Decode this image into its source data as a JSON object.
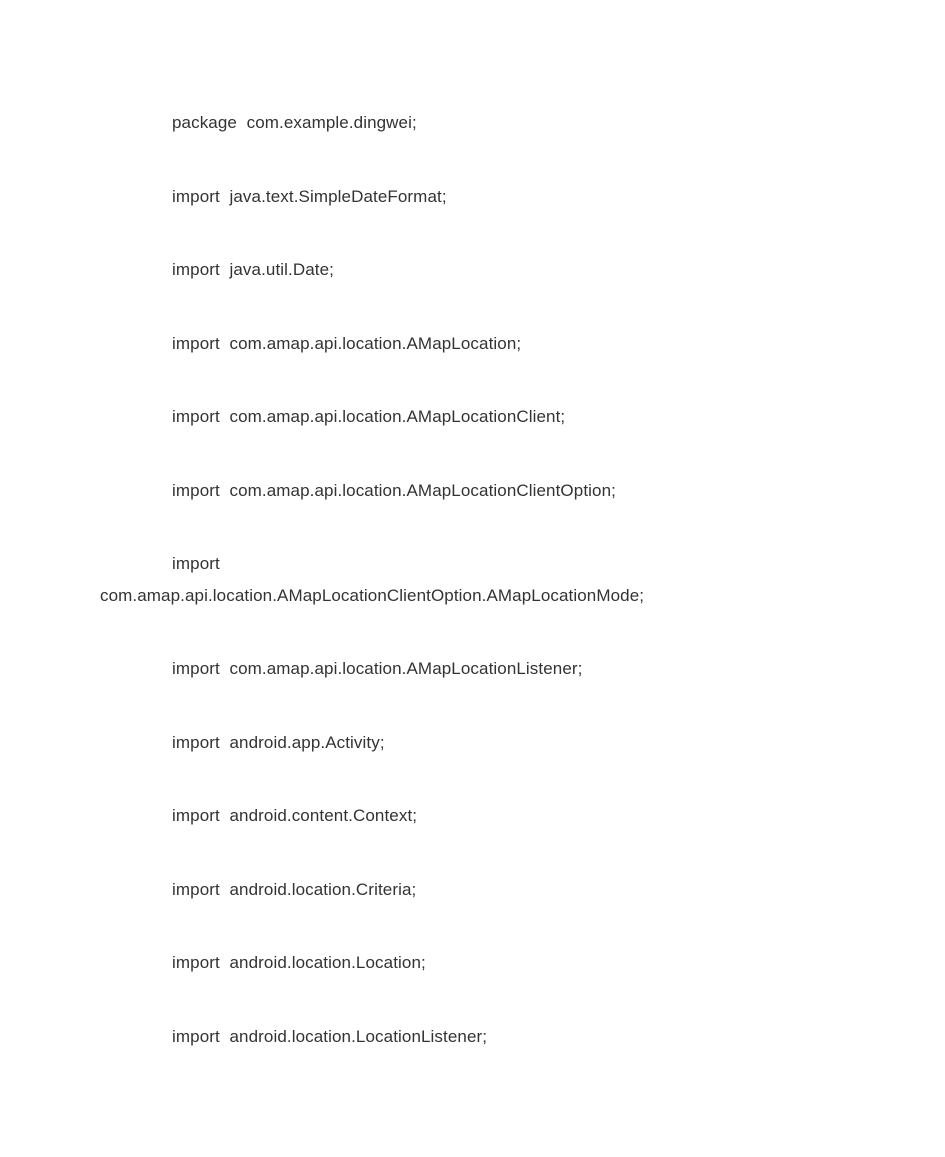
{
  "code": {
    "lines": [
      "package  com.example.dingwei;",
      "import  java.text.SimpleDateFormat;",
      "import  java.util.Date;",
      "import  com.amap.api.location.AMapLocation;",
      "import  com.amap.api.location.AMapLocationClient;",
      "import  com.amap.api.location.AMapLocationClientOption;"
    ],
    "wrapped_import_head": "import",
    "wrapped_import_tail": "com.amap.api.location.AMapLocationClientOption.AMapLocationMode;",
    "lines_after": [
      "import  com.amap.api.location.AMapLocationListener;",
      "import  android.app.Activity;",
      "import  android.content.Context;",
      "import  android.location.Criteria;",
      "import  android.location.Location;",
      "import  android.location.LocationListener;"
    ]
  }
}
